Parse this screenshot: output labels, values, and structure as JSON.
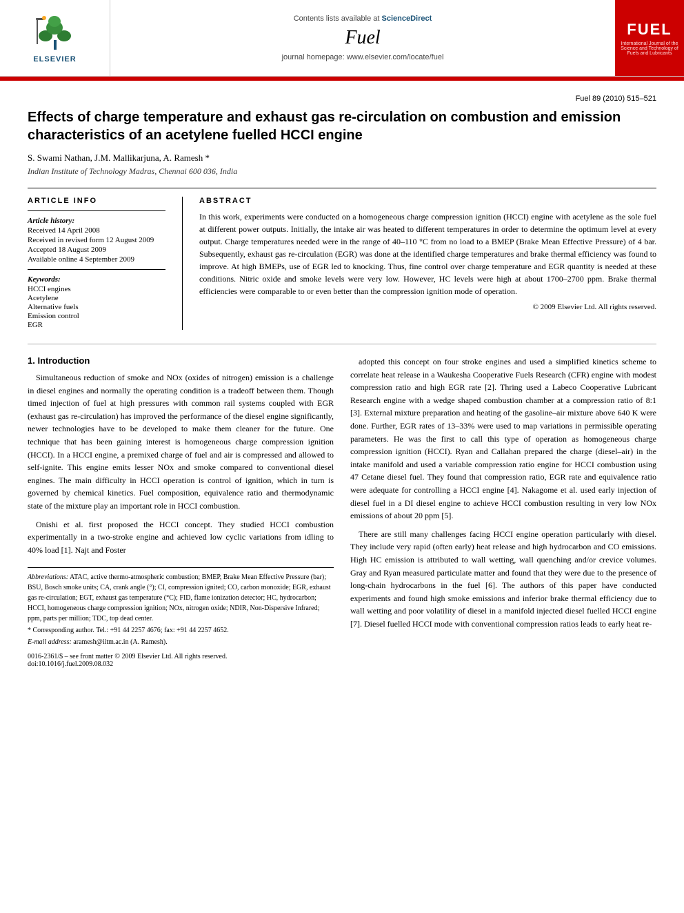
{
  "header": {
    "sciencedirect_label": "Contents lists available at",
    "sciencedirect_link": "ScienceDirect",
    "journal_title": "Fuel",
    "homepage_label": "journal homepage: www.elsevier.com/locate/fuel",
    "elsevier_brand": "ELSEVIER",
    "fuel_logo": "FUEL",
    "fuel_logo_sub": "International Journal of the Science\nand Technology of Fuels\nand Lubricants"
  },
  "paper": {
    "title": "Effects of charge temperature and exhaust gas re-circulation on combustion and emission characteristics of an acetylene fuelled HCCI engine",
    "authors": "S. Swami Nathan, J.M. Mallikarjuna, A. Ramesh *",
    "affiliation": "Indian Institute of Technology Madras, Chennai 600 036, India",
    "journal_ref": "Fuel 89 (2010) 515–521"
  },
  "article_info": {
    "section_title": "ARTICLE INFO",
    "history_label": "Article history:",
    "received": "Received 14 April 2008",
    "revised": "Received in revised form 12 August 2009",
    "accepted": "Accepted 18 August 2009",
    "available": "Available online 4 September 2009",
    "keywords_label": "Keywords:",
    "keywords": [
      "HCCI engines",
      "Acetylene",
      "Alternative fuels",
      "Emission control",
      "EGR"
    ]
  },
  "abstract": {
    "section_title": "ABSTRACT",
    "text": "In this work, experiments were conducted on a homogeneous charge compression ignition (HCCI) engine with acetylene as the sole fuel at different power outputs. Initially, the intake air was heated to different temperatures in order to determine the optimum level at every output. Charge temperatures needed were in the range of 40–110 °C from no load to a BMEP (Brake Mean Effective Pressure) of 4 bar. Subsequently, exhaust gas re-circulation (EGR) was done at the identified charge temperatures and brake thermal efficiency was found to improve. At high BMEPs, use of EGR led to knocking. Thus, fine control over charge temperature and EGR quantity is needed at these conditions. Nitric oxide and smoke levels were very low. However, HC levels were high at about 1700–2700 ppm. Brake thermal efficiencies were comparable to or even better than the compression ignition mode of operation.",
    "copyright": "© 2009 Elsevier Ltd. All rights reserved."
  },
  "introduction": {
    "heading": "1. Introduction",
    "para1": "Simultaneous reduction of smoke and NOx (oxides of nitrogen) emission is a challenge in diesel engines and normally the operating condition is a tradeoff between them. Though timed injection of fuel at high pressures with common rail systems coupled with EGR (exhaust gas re-circulation) has improved the performance of the diesel engine significantly, newer technologies have to be developed to make them cleaner for the future. One technique that has been gaining interest is homogeneous charge compression ignition (HCCI). In a HCCI engine, a premixed charge of fuel and air is compressed and allowed to self-ignite. This engine emits lesser NOx and smoke compared to conventional diesel engines. The main difficulty in HCCI operation is control of ignition, which in turn is governed by chemical kinetics. Fuel composition, equivalence ratio and thermodynamic state of the mixture play an important role in HCCI combustion.",
    "para2": "Onishi et al. first proposed the HCCI concept. They studied HCCI combustion experimentally in a two-stroke engine and achieved low cyclic variations from idling to 40% load [1]. Najt and Foster"
  },
  "right_col": {
    "para1": "adopted this concept on four stroke engines and used a simplified kinetics scheme to correlate heat release in a Waukesha Cooperative Fuels Research (CFR) engine with modest compression ratio and high EGR rate [2]. Thring used a Labeco Cooperative Lubricant Research engine with a wedge shaped combustion chamber at a compression ratio of 8:1 [3]. External mixture preparation and heating of the gasoline–air mixture above 640 K were done. Further, EGR rates of 13–33% were used to map variations in permissible operating parameters. He was the first to call this type of operation as homogeneous charge compression ignition (HCCI). Ryan and Callahan prepared the charge (diesel–air) in the intake manifold and used a variable compression ratio engine for HCCI combustion using 47 Cetane diesel fuel. They found that compression ratio, EGR rate and equivalence ratio were adequate for controlling a HCCI engine [4]. Nakagome et al. used early injection of diesel fuel in a DI diesel engine to achieve HCCI combustion resulting in very low NOx emissions of about 20 ppm [5].",
    "para2": "There are still many challenges facing HCCI engine operation particularly with diesel. They include very rapid (often early) heat release and high hydrocarbon and CO emissions. High HC emission is attributed to wall wetting, wall quenching and/or crevice volumes. Gray and Ryan measured particulate matter and found that they were due to the presence of long-chain hydrocarbons in the fuel [6]. The authors of this paper have conducted experiments and found high smoke emissions and inferior brake thermal efficiency due to wall wetting and poor volatility of diesel in a manifold injected diesel fuelled HCCI engine [7]. Diesel fuelled HCCI mode with conventional compression ratios leads to early heat re-"
  },
  "footnotes": {
    "abbreviations_label": "Abbreviations:",
    "abbreviations_text": "ATAC, active thermo-atmospheric combustion; BMEP, Brake Mean Effective Pressure (bar); BSU, Bosch smoke units; CA, crank angle (°); CI, compression ignited; CO, carbon monoxide; EGR, exhaust gas re-circulation; EGT, exhaust gas temperature (°C); FID, flame ionization detector; HC, hydrocarbon; HCCI, homogeneous charge compression ignition; NOx, nitrogen oxide; NDIR, Non-Dispersive Infrared; ppm, parts per million; TDC, top dead center.",
    "corresponding_label": "* Corresponding author.",
    "tel": "Tel.: +91 44 2257 4676; fax: +91 44 2257 4652.",
    "email_label": "E-mail address:",
    "email": "aramesh@iitm.ac.in (A. Ramesh).",
    "issn": "0016-2361/$ – see front matter © 2009 Elsevier Ltd. All rights reserved.",
    "doi": "doi:10.1016/j.fuel.2009.08.032"
  }
}
